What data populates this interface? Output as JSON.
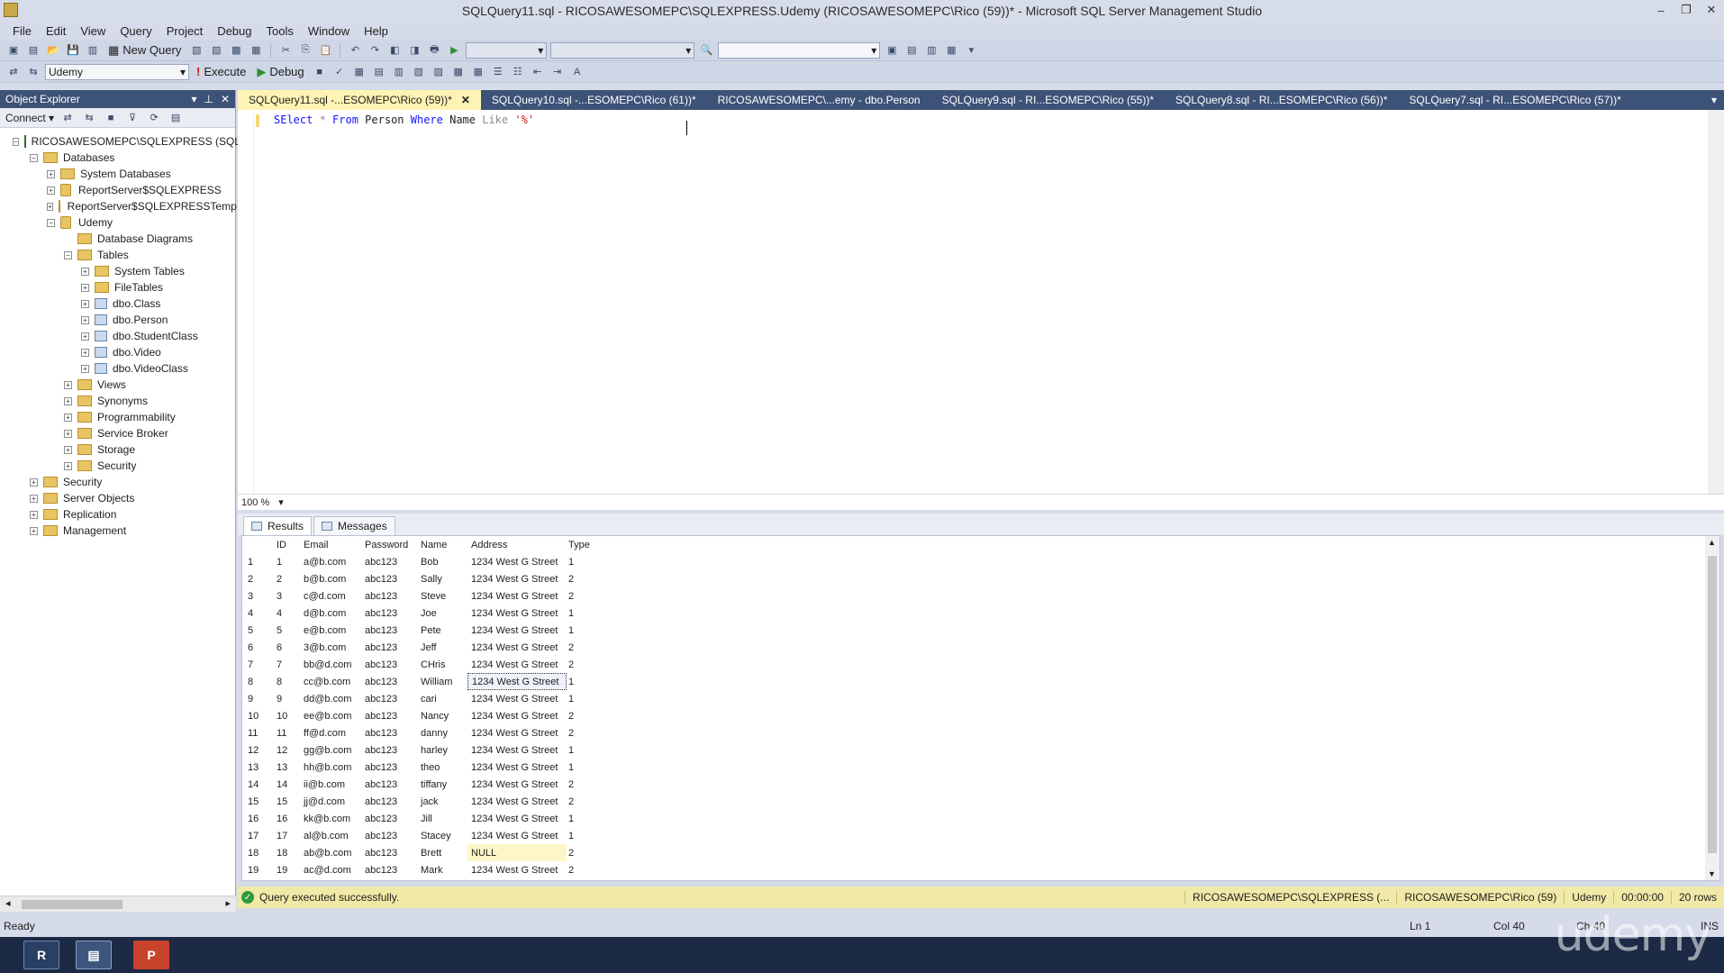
{
  "window": {
    "title": "SQLQuery11.sql - RICOSAWESOMEPC\\SQLEXPRESS.Udemy (RICOSAWESOMEPC\\Rico (59))* - Microsoft SQL Server Management Studio",
    "min": "–",
    "restore": "❐",
    "close": "✕"
  },
  "menu": [
    "File",
    "Edit",
    "View",
    "Query",
    "Project",
    "Debug",
    "Tools",
    "Window",
    "Help"
  ],
  "toolbar": {
    "new_query": "New Query",
    "database": "Udemy",
    "execute": "Execute",
    "debug": "Debug"
  },
  "object_explorer": {
    "title": "Object Explorer",
    "connect": "Connect ▾",
    "nodes": [
      {
        "label": "RICOSAWESOMEPC\\SQLEXPRESS (SQL",
        "depth": 0,
        "toggle": "−",
        "icon": "server"
      },
      {
        "label": "Databases",
        "depth": 1,
        "toggle": "−",
        "icon": "folder"
      },
      {
        "label": "System Databases",
        "depth": 2,
        "toggle": "+",
        "icon": "folder"
      },
      {
        "label": "ReportServer$SQLEXPRESS",
        "depth": 2,
        "toggle": "+",
        "icon": "db"
      },
      {
        "label": "ReportServer$SQLEXPRESSTemp",
        "depth": 2,
        "toggle": "+",
        "icon": "db"
      },
      {
        "label": "Udemy",
        "depth": 2,
        "toggle": "−",
        "icon": "db"
      },
      {
        "label": "Database Diagrams",
        "depth": 3,
        "toggle": "",
        "icon": "folder"
      },
      {
        "label": "Tables",
        "depth": 3,
        "toggle": "−",
        "icon": "folder"
      },
      {
        "label": "System Tables",
        "depth": 4,
        "toggle": "+",
        "icon": "folder"
      },
      {
        "label": "FileTables",
        "depth": 4,
        "toggle": "+",
        "icon": "folder"
      },
      {
        "label": "dbo.Class",
        "depth": 4,
        "toggle": "+",
        "icon": "table"
      },
      {
        "label": "dbo.Person",
        "depth": 4,
        "toggle": "+",
        "icon": "table"
      },
      {
        "label": "dbo.StudentClass",
        "depth": 4,
        "toggle": "+",
        "icon": "table"
      },
      {
        "label": "dbo.Video",
        "depth": 4,
        "toggle": "+",
        "icon": "table"
      },
      {
        "label": "dbo.VideoClass",
        "depth": 4,
        "toggle": "+",
        "icon": "table"
      },
      {
        "label": "Views",
        "depth": 3,
        "toggle": "+",
        "icon": "folder"
      },
      {
        "label": "Synonyms",
        "depth": 3,
        "toggle": "+",
        "icon": "folder"
      },
      {
        "label": "Programmability",
        "depth": 3,
        "toggle": "+",
        "icon": "folder"
      },
      {
        "label": "Service Broker",
        "depth": 3,
        "toggle": "+",
        "icon": "folder"
      },
      {
        "label": "Storage",
        "depth": 3,
        "toggle": "+",
        "icon": "folder"
      },
      {
        "label": "Security",
        "depth": 3,
        "toggle": "+",
        "icon": "folder"
      },
      {
        "label": "Security",
        "depth": 1,
        "toggle": "+",
        "icon": "folder"
      },
      {
        "label": "Server Objects",
        "depth": 1,
        "toggle": "+",
        "icon": "folder"
      },
      {
        "label": "Replication",
        "depth": 1,
        "toggle": "+",
        "icon": "folder"
      },
      {
        "label": "Management",
        "depth": 1,
        "toggle": "+",
        "icon": "folder"
      }
    ]
  },
  "tabs": [
    {
      "label": "SQLQuery11.sql -...ESOMEPC\\Rico (59))*",
      "active": true
    },
    {
      "label": "SQLQuery10.sql -...ESOMEPC\\Rico (61))*",
      "active": false
    },
    {
      "label": "RICOSAWESOMEPC\\...emy - dbo.Person",
      "active": false
    },
    {
      "label": "SQLQuery9.sql - RI...ESOMEPC\\Rico (55))*",
      "active": false
    },
    {
      "label": "SQLQuery8.sql - RI...ESOMEPC\\Rico (56))*",
      "active": false
    },
    {
      "label": "SQLQuery7.sql - RI...ESOMEPC\\Rico (57))*",
      "active": false
    }
  ],
  "editor": {
    "sql": {
      "kw1": "SElect",
      "star": " * ",
      "kw2": "From",
      "tbl": " Person ",
      "kw3": "Where",
      "col": " Name ",
      "op": "Like",
      "str": " '%'"
    },
    "zoom": "100 %"
  },
  "results": {
    "tabs": [
      "Results",
      "Messages"
    ],
    "columns": [
      "ID",
      "Email",
      "Password",
      "Name",
      "Address",
      "Type"
    ],
    "rows": [
      [
        "1",
        "1",
        "a@b.com",
        "abc123",
        "Bob",
        "1234 West G Street",
        "1"
      ],
      [
        "2",
        "2",
        "b@b.com",
        "abc123",
        "Sally",
        "1234 West G Street",
        "2"
      ],
      [
        "3",
        "3",
        "c@d.com",
        "abc123",
        "Steve",
        "1234 West G Street",
        "2"
      ],
      [
        "4",
        "4",
        "d@b.com",
        "abc123",
        "Joe",
        "1234 West G Street",
        "1"
      ],
      [
        "5",
        "5",
        "e@b.com",
        "abc123",
        "Pete",
        "1234 West G Street",
        "1"
      ],
      [
        "6",
        "6",
        "3@b.com",
        "abc123",
        "Jeff",
        "1234 West G Street",
        "2"
      ],
      [
        "7",
        "7",
        "bb@d.com",
        "abc123",
        "CHris",
        "1234 West G Street",
        "2"
      ],
      [
        "8",
        "8",
        "cc@b.com",
        "abc123",
        "William",
        "1234 West G Street",
        "1"
      ],
      [
        "9",
        "9",
        "dd@b.com",
        "abc123",
        "cari",
        "1234 West G Street",
        "1"
      ],
      [
        "10",
        "10",
        "ee@b.com",
        "abc123",
        "Nancy",
        "1234 West G Street",
        "2"
      ],
      [
        "11",
        "11",
        "ff@d.com",
        "abc123",
        "danny",
        "1234 West G Street",
        "2"
      ],
      [
        "12",
        "12",
        "gg@b.com",
        "abc123",
        "harley",
        "1234 West G Street",
        "1"
      ],
      [
        "13",
        "13",
        "hh@b.com",
        "abc123",
        "theo",
        "1234 West G Street",
        "1"
      ],
      [
        "14",
        "14",
        "ii@b.com",
        "abc123",
        "tiffany",
        "1234 West G Street",
        "2"
      ],
      [
        "15",
        "15",
        "jj@d.com",
        "abc123",
        "jack",
        "1234 West G Street",
        "2"
      ],
      [
        "16",
        "16",
        "kk@b.com",
        "abc123",
        "Jill",
        "1234 West G Street",
        "1"
      ],
      [
        "17",
        "17",
        "al@b.com",
        "abc123",
        "Stacey",
        "1234 West G Street",
        "1"
      ],
      [
        "18",
        "18",
        "ab@b.com",
        "abc123",
        "Brett",
        "NULL",
        "2"
      ],
      [
        "19",
        "19",
        "ac@d.com",
        "abc123",
        "Mark",
        "1234 West G Street",
        "2"
      ]
    ]
  },
  "query_status": {
    "message": "Query executed successfully.",
    "server": "RICOSAWESOMEPC\\SQLEXPRESS (...",
    "user": "RICOSAWESOMEPC\\Rico (59)",
    "database": "Udemy",
    "time": "00:00:00",
    "rows": "20 rows"
  },
  "app_status": {
    "ready": "Ready",
    "ln": "Ln 1",
    "col": "Col 40",
    "ch": "Ch 40",
    "mode": "INS"
  },
  "watermark": "udemy"
}
